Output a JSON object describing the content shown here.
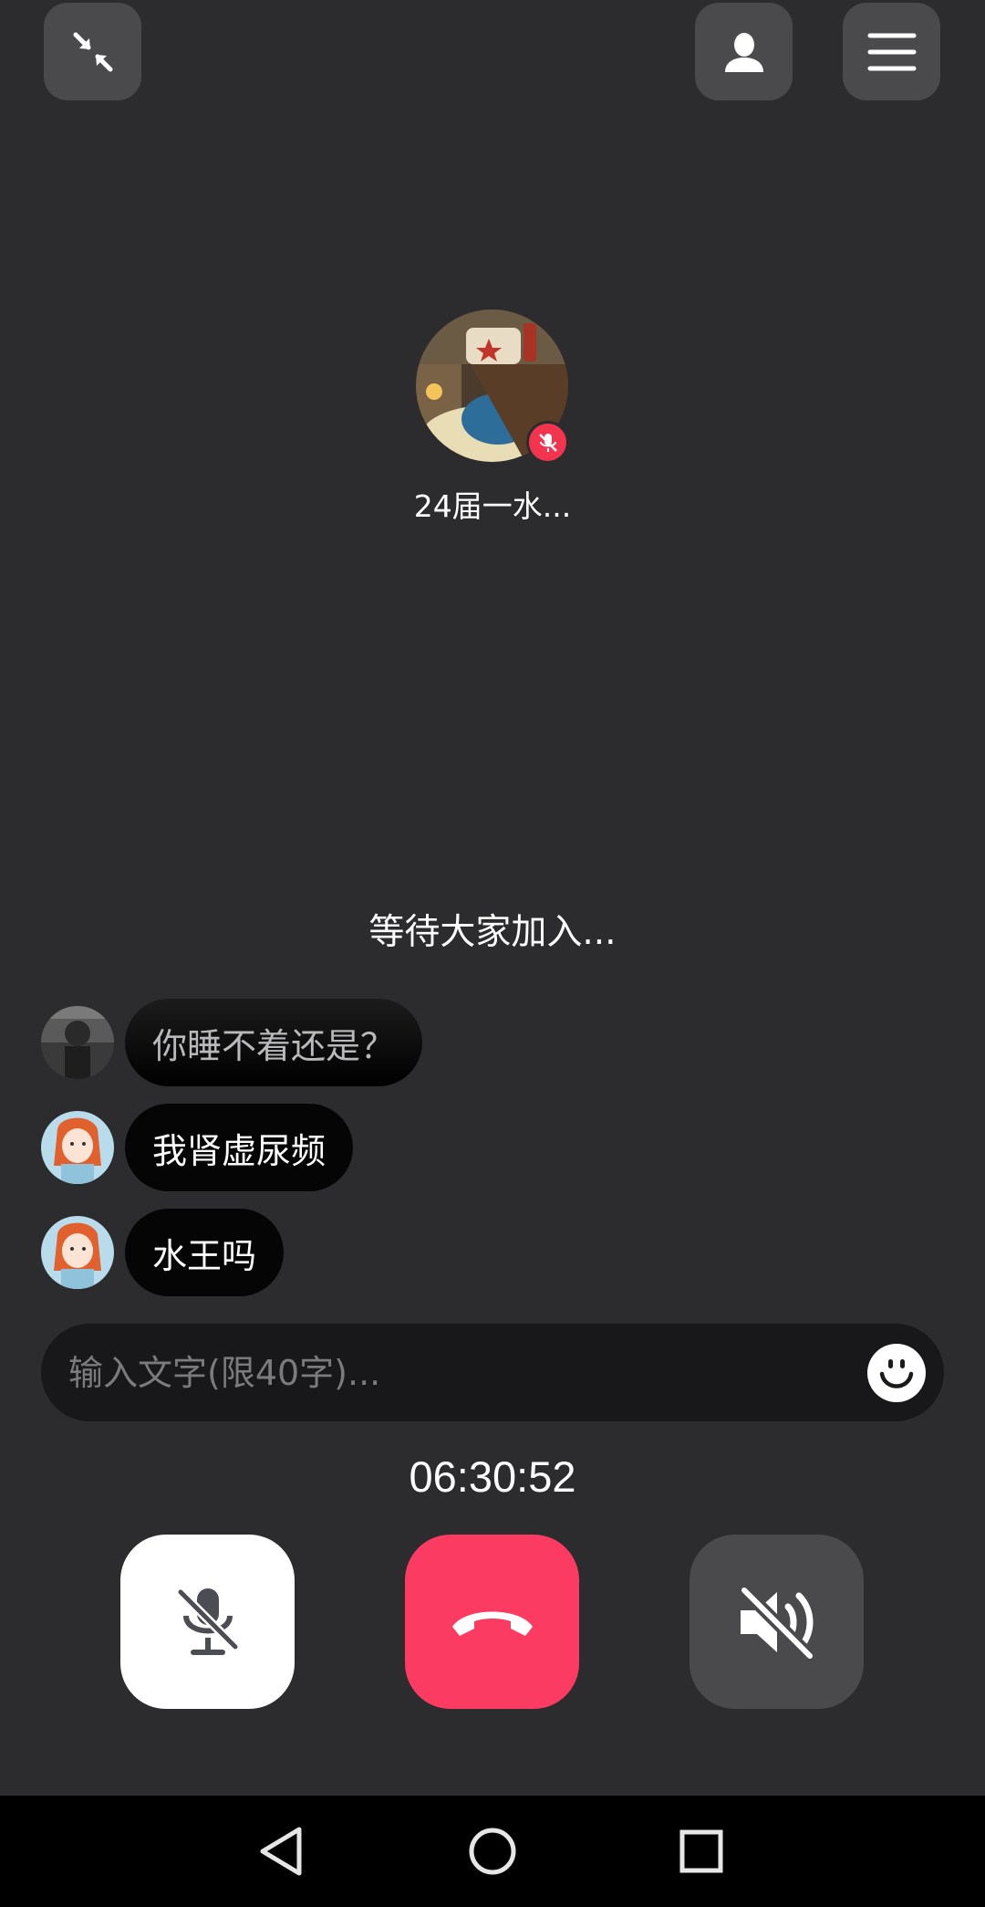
{
  "top_bar": {
    "minimize_icon": "minimize-arrows-icon",
    "members_icon": "person-icon",
    "menu_icon": "hamburger-menu-icon"
  },
  "caller": {
    "name": "24届一水...",
    "muted": true
  },
  "status_text": "等待大家加入...",
  "messages": [
    {
      "text": "你睡不着还是？",
      "faded": true
    },
    {
      "text": "我肾虚尿频",
      "faded": false
    },
    {
      "text": "水王吗",
      "faded": false
    }
  ],
  "input": {
    "placeholder": "输入文字(限40字)...",
    "value": ""
  },
  "timer": "06:30:52",
  "controls": {
    "mic_icon": "mic-off-icon",
    "hangup_icon": "phone-hangup-icon",
    "speaker_icon": "speaker-muted-icon"
  },
  "colors": {
    "background": "#2c2c2e",
    "hangup": "#fb3b62",
    "mute_badge": "#f2344f",
    "button_gray": "#4a4a4d"
  }
}
